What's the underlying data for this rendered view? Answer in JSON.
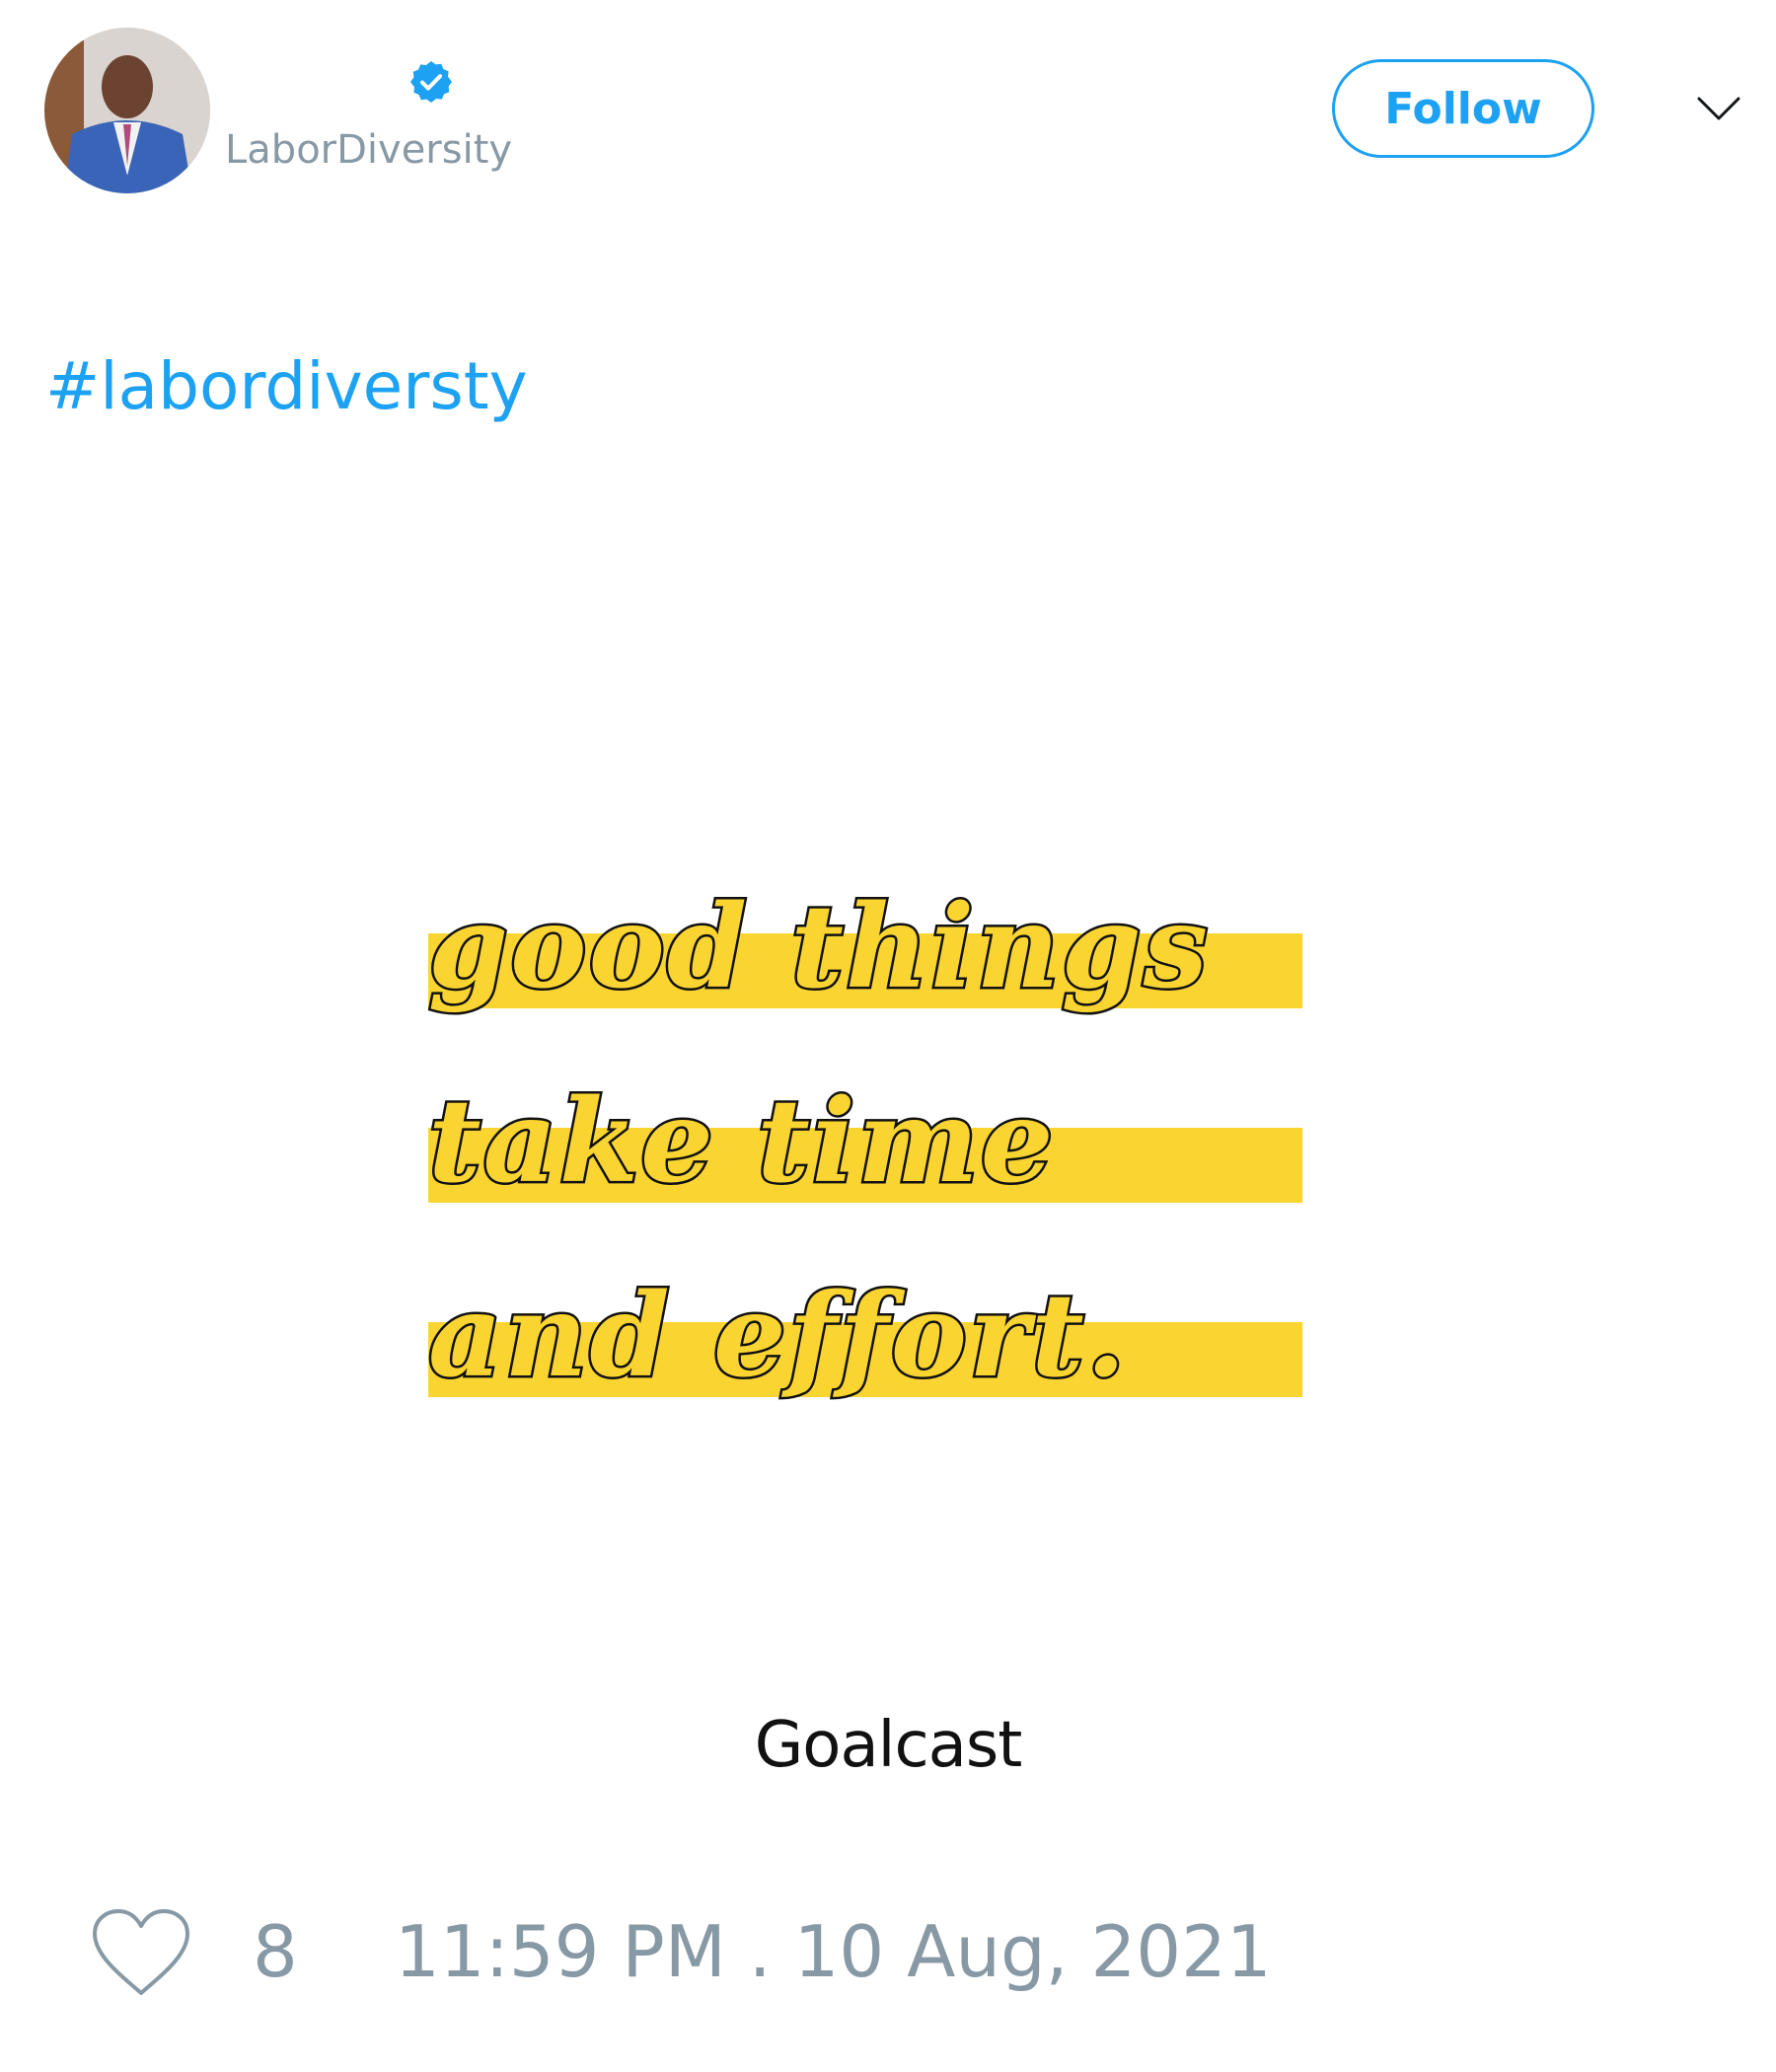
{
  "tweet": {
    "author": {
      "handle": "LaborDiversity",
      "verified": true
    },
    "follow_label": "Follow",
    "text_hashtag": "#labordiversty",
    "media": {
      "quote_lines": [
        "good things",
        "take time",
        "and effort."
      ],
      "brand": "Goalcast",
      "highlight_color": "#fad531"
    },
    "footer": {
      "like_count": "8",
      "timestamp": "11:59 PM . 10 Aug, 2021"
    }
  },
  "colors": {
    "accent": "#1da1f2",
    "muted": "#8899a6"
  },
  "icons": {
    "verified": "verified-badge-icon",
    "menu": "chevron-down-icon",
    "like": "heart-icon"
  }
}
